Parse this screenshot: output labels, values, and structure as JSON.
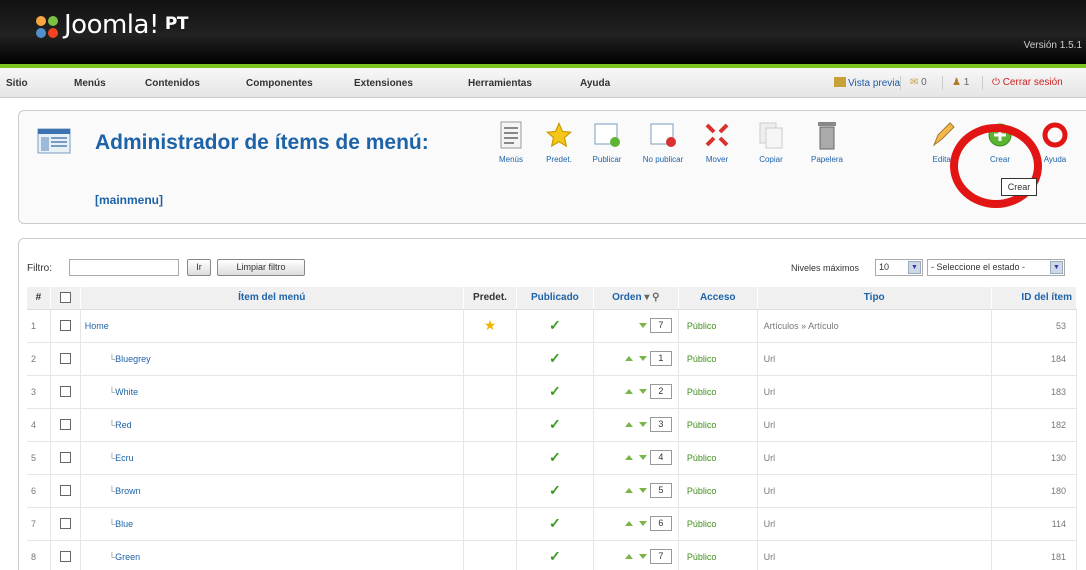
{
  "brand": {
    "name": "Joomla!",
    "suffix": "PT",
    "version": "Versión 1.5.1"
  },
  "menubar": {
    "items": [
      "Sitio",
      "Menús",
      "Contenidos",
      "Componentes",
      "Extensiones",
      "Herramientas",
      "Ayuda"
    ],
    "preview": "Vista previa",
    "messages": "0",
    "users": "1",
    "logout": "Cerrar sesión"
  },
  "page": {
    "title": "Administrador de ítems de menú:",
    "subtitle": "[mainmenu]"
  },
  "toolbar": {
    "buttons": [
      "Menús",
      "Predet.",
      "Publicar",
      "No publicar",
      "Mover",
      "Copiar",
      "Papelera",
      "Editar",
      "Crear",
      "Ayuda"
    ],
    "tooltip": "Crear"
  },
  "filter": {
    "label": "Filtro:",
    "value": "",
    "go": "Ir",
    "reset": "Limpiar filtro",
    "levels_label": "Niveles máximos",
    "levels_value": "10",
    "state_value": "- Seleccione el estado -"
  },
  "table": {
    "headers": [
      "#",
      "",
      "Ítem del menú",
      "Predet.",
      "Publicado",
      "Orden",
      "Acceso",
      "Tipo",
      "ID del ítem"
    ],
    "rows": [
      {
        "num": "1",
        "name": "Home",
        "level": 0,
        "default": true,
        "order": "7",
        "access": "Público",
        "type": "Artículos » Artículo",
        "id": "53"
      },
      {
        "num": "2",
        "name": "Bluegrey",
        "level": 1,
        "default": false,
        "order": "1",
        "access": "Público",
        "type": "Url",
        "id": "184"
      },
      {
        "num": "3",
        "name": "White",
        "level": 1,
        "default": false,
        "order": "2",
        "access": "Público",
        "type": "Url",
        "id": "183"
      },
      {
        "num": "4",
        "name": "Red",
        "level": 1,
        "default": false,
        "order": "3",
        "access": "Público",
        "type": "Url",
        "id": "182"
      },
      {
        "num": "5",
        "name": "Ecru",
        "level": 1,
        "default": false,
        "order": "4",
        "access": "Público",
        "type": "Url",
        "id": "130"
      },
      {
        "num": "6",
        "name": "Brown",
        "level": 1,
        "default": false,
        "order": "5",
        "access": "Público",
        "type": "Url",
        "id": "180"
      },
      {
        "num": "7",
        "name": "Blue",
        "level": 1,
        "default": false,
        "order": "6",
        "access": "Público",
        "type": "Url",
        "id": "114"
      },
      {
        "num": "8",
        "name": "Green",
        "level": 1,
        "default": false,
        "order": "7",
        "access": "Público",
        "type": "Url",
        "id": "181"
      }
    ]
  },
  "colors": {
    "accent": "#1e63a8",
    "highlight": "#e21515",
    "brandbar": "#7bc31f"
  }
}
